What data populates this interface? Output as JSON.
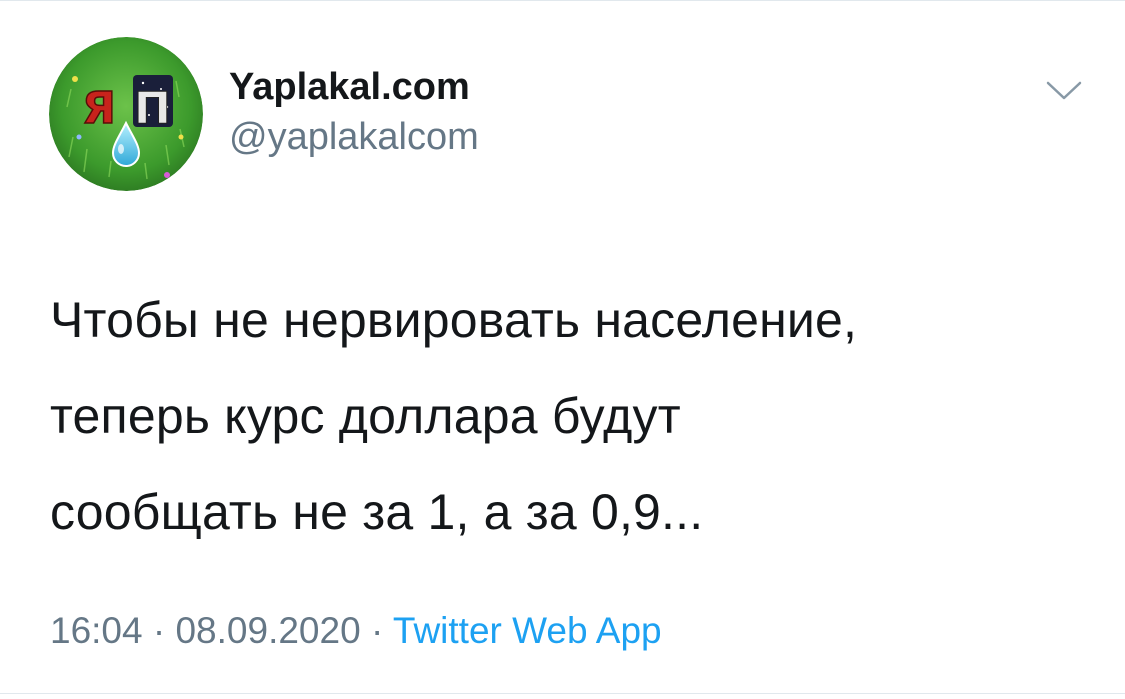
{
  "tweet": {
    "author": {
      "display_name": "Yaplakal.com",
      "handle": "@yaplakalcom",
      "avatar_text": "ЯП"
    },
    "text": "Чтобы не нервировать население,\nтеперь курс доллара будут\nсообщать не за 1, а за 0,9...",
    "meta": {
      "time": "16:04",
      "date": "08.09.2020",
      "separator": " · ",
      "source": "Twitter Web App"
    },
    "menu_icon": "chevron-down-icon"
  },
  "colors": {
    "text_primary": "#14171a",
    "text_secondary": "#657786",
    "link": "#1da1f2",
    "divider": "#e1e8ed",
    "avatar_green": "#3f9d2f",
    "avatar_red": "#c8231c"
  }
}
